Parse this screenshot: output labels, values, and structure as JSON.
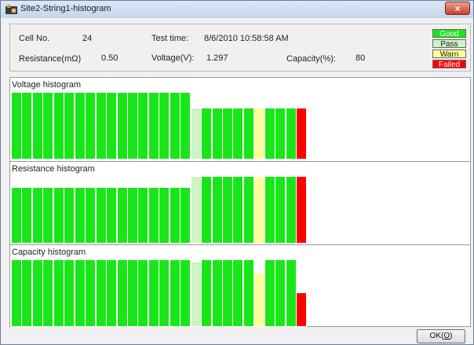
{
  "window": {
    "title": "Site2-String1-histogram",
    "close_label": "×"
  },
  "info": {
    "cell_no_label": "Cell No.",
    "cell_no_value": "24",
    "test_time_label": "Test time:",
    "test_time_value": "8/6/2010 10:58:58 AM",
    "resistance_label": "Resistance(mΩ)",
    "resistance_value": "0.50",
    "voltage_label": "Voltage(V):",
    "voltage_value": "1.297",
    "capacity_label": "Capacity(%):",
    "capacity_value": "80"
  },
  "legend": [
    {
      "label": "Good",
      "color": "#19e619",
      "text_color": "#ffffff"
    },
    {
      "label": "Pass",
      "color": "#ccf5c5",
      "text_color": "#1a1a1a"
    },
    {
      "label": "Warn",
      "color": "#ffff99",
      "text_color": "#1a1a1a"
    },
    {
      "label": "Failed",
      "color": "#ff0000",
      "text_color": "#ffffff"
    }
  ],
  "colors": {
    "good": "#19e619",
    "pass": "#ccf5c5",
    "warn": "#ffff99",
    "failed": "#ff0000"
  },
  "histograms": [
    {
      "title": "Voltage histogram"
    },
    {
      "title": "Resistance histogram"
    },
    {
      "title": "Capacity histogram"
    }
  ],
  "chart_data": [
    {
      "type": "bar",
      "title": "Voltage histogram",
      "status": [
        "good",
        "good",
        "good",
        "good",
        "good",
        "good",
        "good",
        "good",
        "good",
        "good",
        "good",
        "good",
        "good",
        "good",
        "good",
        "good",
        "good",
        "pass",
        "good",
        "good",
        "good",
        "good",
        "good",
        "warn",
        "good",
        "good",
        "good",
        "failed"
      ],
      "values": [
        1,
        1,
        1,
        1,
        1,
        1,
        1,
        1,
        1,
        1,
        1,
        1,
        1,
        1,
        1,
        1,
        1,
        0.77,
        0.77,
        0.77,
        0.77,
        0.77,
        0.77,
        0.77,
        0.77,
        0.77,
        0.77,
        0.77
      ]
    },
    {
      "type": "bar",
      "title": "Resistance histogram",
      "status": [
        "good",
        "good",
        "good",
        "good",
        "good",
        "good",
        "good",
        "good",
        "good",
        "good",
        "good",
        "good",
        "good",
        "good",
        "good",
        "good",
        "good",
        "pass",
        "good",
        "good",
        "good",
        "good",
        "good",
        "warn",
        "good",
        "good",
        "good",
        "failed"
      ],
      "values": [
        0.84,
        0.84,
        0.84,
        0.84,
        0.84,
        0.84,
        0.84,
        0.84,
        0.84,
        0.84,
        0.84,
        0.84,
        0.84,
        0.84,
        0.84,
        0.84,
        0.84,
        1,
        1,
        1,
        1,
        1,
        1,
        1,
        1,
        1,
        1,
        1
      ]
    },
    {
      "type": "bar",
      "title": "Capacity histogram",
      "status": [
        "good",
        "good",
        "good",
        "good",
        "good",
        "good",
        "good",
        "good",
        "good",
        "good",
        "good",
        "good",
        "good",
        "good",
        "good",
        "good",
        "good",
        "pass",
        "good",
        "good",
        "good",
        "good",
        "good",
        "warn",
        "good",
        "good",
        "good",
        "failed"
      ],
      "values": [
        1,
        1,
        1,
        1,
        1,
        1,
        1,
        1,
        1,
        1,
        1,
        1,
        1,
        1,
        1,
        1,
        1,
        0.97,
        1,
        1,
        1,
        1,
        1,
        0.8,
        1,
        1,
        1,
        0.51
      ]
    }
  ],
  "ok_button": {
    "label": "OK(",
    "hotkey": "O",
    "label_end": ")"
  }
}
